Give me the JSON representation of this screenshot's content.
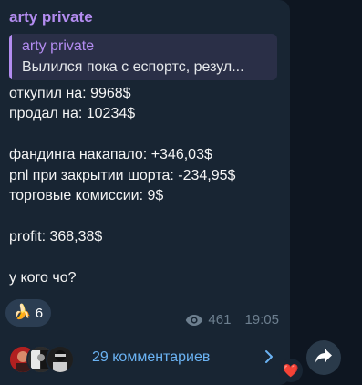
{
  "post": {
    "sender": "arty private",
    "reply": {
      "title": "arty private",
      "text": "Вылился пока с еспортс, резул..."
    },
    "lines": [
      "откупил на: 9968$",
      "продал на: 10234$",
      "",
      "фандинга накапало: +346,03$",
      "pnl при закрытии шорта: -234,95$",
      "торговые комиссии: 9$",
      "",
      "profit: 368,38$",
      "",
      "у кого чо?"
    ],
    "reaction": {
      "emoji": "🍌",
      "count": "6"
    },
    "views": "461",
    "time": "19:05",
    "comments_label": "29 комментариев",
    "heart_emoji": "❤️"
  },
  "colors": {
    "background": "#0e1621",
    "bubble": "#182533",
    "accent": "#b38cf0",
    "link": "#6ab2f2",
    "meta": "#6d7f8f"
  },
  "icons": {
    "views": "eye-icon",
    "comments_arrow": "chevron-right-icon",
    "share": "share-arrow-icon"
  }
}
